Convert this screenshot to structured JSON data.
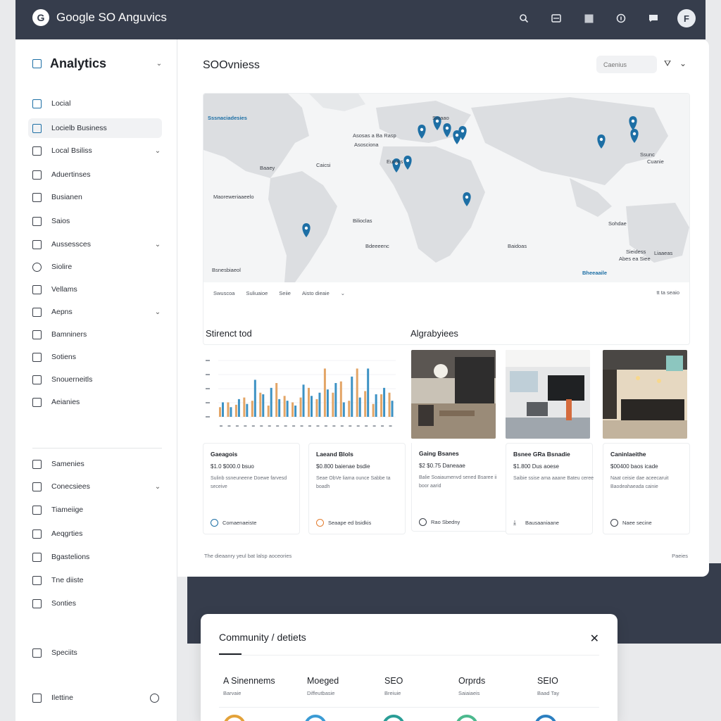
{
  "app": {
    "title": "Google SO Anguvics",
    "logo": "G"
  },
  "topbar": {
    "icons": [
      "search-icon",
      "inbox-icon",
      "grid-icon",
      "help-icon",
      "chat-icon"
    ],
    "avatar": "F"
  },
  "sidebar": {
    "title": "Analytics",
    "items": [
      {
        "label": "Locial",
        "icon": "dashboard-icon"
      },
      {
        "label": "Locielb Business",
        "icon": "business-icon",
        "active": true
      },
      {
        "label": "Local Bsiliss",
        "icon": "store-icon",
        "chevron": true
      },
      {
        "label": "Aduertinses",
        "icon": "ads-icon"
      },
      {
        "label": "Busianen",
        "icon": "list-icon"
      },
      {
        "label": "Saios",
        "icon": "sales-icon"
      },
      {
        "label": "Aussessces",
        "icon": "audience-icon",
        "chevron": true
      },
      {
        "label": "Siolire",
        "icon": "circle-icon",
        "round": true
      },
      {
        "label": "Vellams",
        "icon": "volume-icon"
      },
      {
        "label": "Aepns",
        "icon": "apps-icon",
        "chevron": true
      },
      {
        "label": "Bamniners",
        "icon": "banner-icon"
      },
      {
        "label": "Sotiens",
        "icon": "settings-icon"
      },
      {
        "label": "Snouerneitls",
        "icon": "sources-icon"
      },
      {
        "label": "Aeianies",
        "icon": "agencies-icon"
      },
      {
        "label": "Samenies",
        "icon": "summaries-icon"
      },
      {
        "label": "Conecsiees",
        "icon": "connections-icon",
        "chevron": true
      },
      {
        "label": "Tiameiige",
        "icon": "timing-icon"
      },
      {
        "label": "Aeqgrties",
        "icon": "aggregates-icon"
      },
      {
        "label": "Bgastelions",
        "icon": "bookmark-icon"
      },
      {
        "label": "Tne diiste",
        "icon": "doc-icon"
      },
      {
        "label": "Sonties",
        "icon": "camera-icon"
      },
      {
        "label": "Speciits",
        "icon": "spec-icon"
      },
      {
        "label": "Ilettine",
        "icon": "settings-cog-icon"
      }
    ]
  },
  "main": {
    "title": "SOOvniess",
    "search_placeholder": "Caenius",
    "map": {
      "labels": [
        {
          "text": "Sssnaciadesies",
          "blue": true
        },
        {
          "text": "Asosas a Ba Rasp"
        },
        {
          "text": "Asosciona"
        },
        {
          "text": "Euruks"
        },
        {
          "text": "Baaey"
        },
        {
          "text": "Caicsi"
        },
        {
          "text": "Smaao"
        },
        {
          "text": "Maoreweriaaeelo"
        },
        {
          "text": "Bilioclas"
        },
        {
          "text": "Bdeeeenc"
        },
        {
          "text": "Bsnesbiaeol"
        },
        {
          "text": "Baidoas"
        },
        {
          "text": "Ssunc"
        },
        {
          "text": "Cuanie"
        },
        {
          "text": "Bheeaaile",
          "blue": true
        },
        {
          "text": "Abes ea Siee"
        },
        {
          "text": "Sieidess"
        },
        {
          "text": "Liaaeas"
        },
        {
          "text": "Sohdae"
        }
      ],
      "footer": [
        "Swuscoa",
        "Suliuaioe",
        "Seiie",
        "Aisto dieaie"
      ],
      "footer_right": "tt ta seaio"
    },
    "chart_section_title": "Stirenct tod",
    "chart_data": {
      "type": "bar",
      "series": [
        {
          "color": "#e3a566",
          "values": [
            12,
            18,
            15,
            24,
            20,
            30,
            14,
            42,
            26,
            18,
            24,
            36,
            22,
            60,
            30,
            44,
            20,
            60,
            32,
            16,
            28,
            30
          ]
        },
        {
          "color": "#3d92c4",
          "values": [
            18,
            12,
            22,
            16,
            46,
            28,
            36,
            22,
            20,
            14,
            40,
            26,
            30,
            34,
            42,
            18,
            50,
            24,
            60,
            28,
            36,
            20
          ]
        }
      ],
      "ylim": [
        0,
        70
      ]
    },
    "gallery_section_title": "Algrabyiees",
    "cards": [
      {
        "title": "Gaeagois",
        "price": "$1.0 $000.0 bsuo",
        "desc": "Sulinb ssneuneene Doewe farvesd seceive",
        "foot": "Comaenaeiste",
        "foot_icon": "blue"
      },
      {
        "title": "Laeand Blols",
        "price": "$0.800 baienae bsdie",
        "desc": "Seae ObVe liama ounce Sabbe ta boadh",
        "foot": "Seaape ed bsidkis",
        "foot_icon": "orange"
      },
      {
        "title": "Gaing Bsanes",
        "price": "$2 $0.75 Daneaae",
        "desc": "Balie Soaiaumenvd sened Bsaree ii boor aarid",
        "foot": "Rao Sbedny",
        "foot_icon": "round"
      },
      {
        "title": "Bsnee GRa Bsnadie",
        "price": "$1.800 Dus aoese",
        "desc": "Saibie ssise ama aaane Bateu ceree",
        "foot": "Bausaaniaane",
        "foot_icon": "none"
      },
      {
        "title": "Caninlaeithe",
        "price": "$00400 baos icade",
        "desc": "Naat ceisie dae aceecaruit Baodeahaeada cainie",
        "foot": "Naee secine",
        "foot_icon": "round"
      }
    ],
    "footer_left": "The dieaanry yeul bat lalsp aoceories",
    "footer_right": "Paeies"
  },
  "modal": {
    "title": "Community / detiets",
    "close": "✕",
    "columns": [
      {
        "name": "A Sinennems",
        "sub": "Barvaie",
        "dot": "#e3a23a"
      },
      {
        "name": "Moeged",
        "sub": "Diffeutbasie",
        "dot": "#3b9bd4"
      },
      {
        "name": "SEO",
        "sub": "Breiuie",
        "dot": "#2a9d96"
      },
      {
        "name": "Orprds",
        "sub": "Saiaiaeis",
        "dot": "#4cb98e"
      },
      {
        "name": "SEIO",
        "sub": "Baad Tay",
        "dot": "#2c7fc0"
      }
    ]
  }
}
